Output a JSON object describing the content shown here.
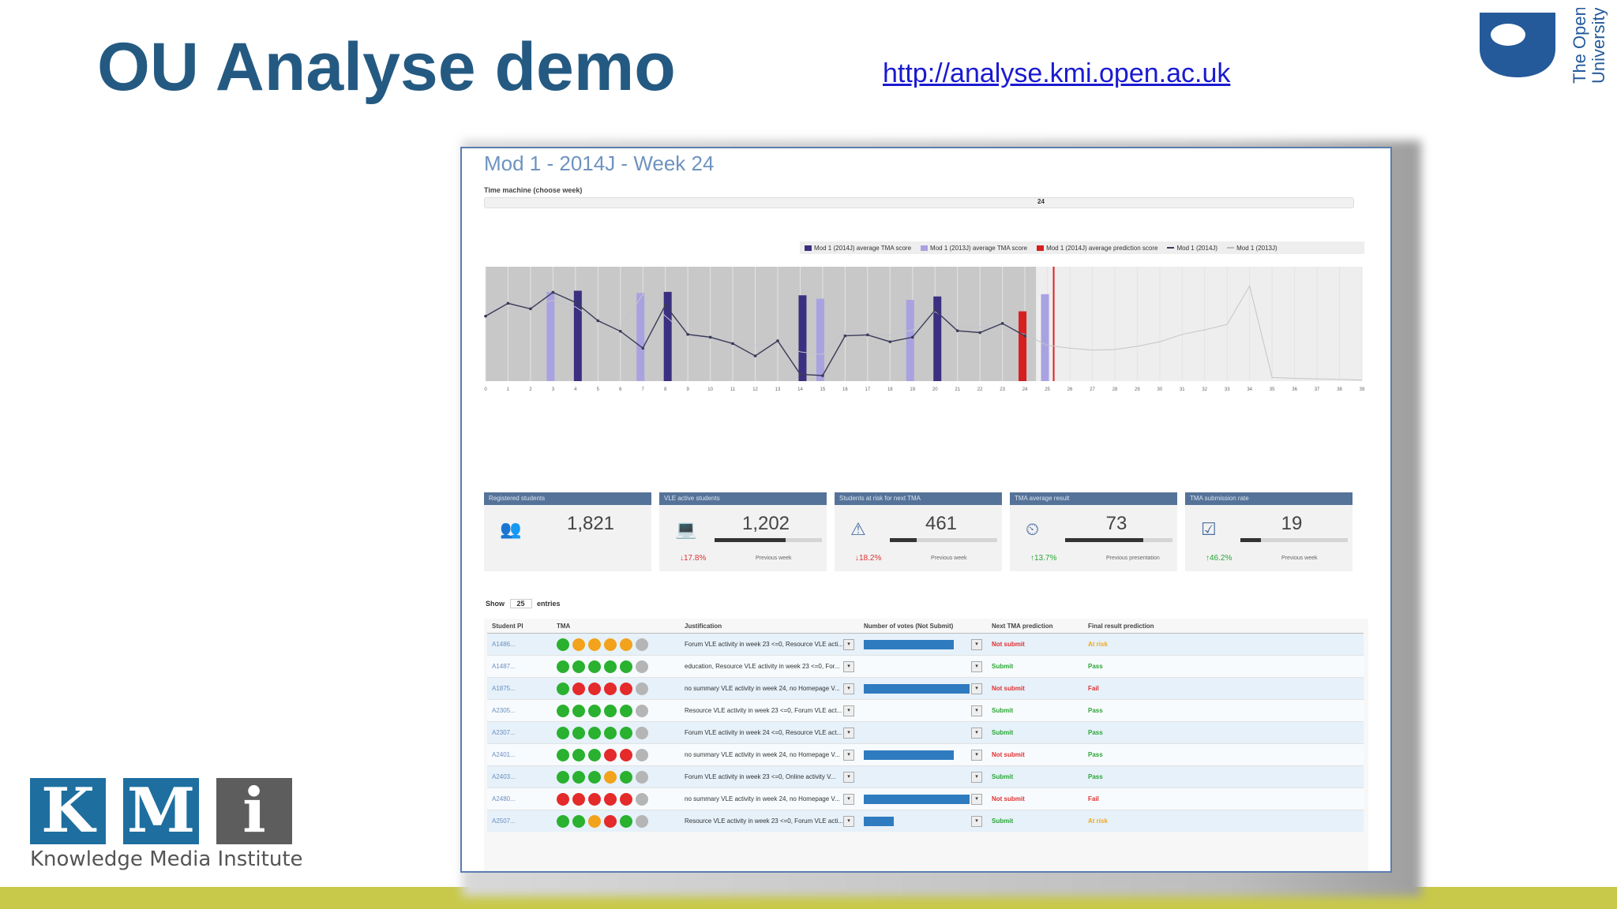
{
  "slide": {
    "title": "OU Analyse demo",
    "link": "http://analyse.kmi.open.ac.uk",
    "ou_logo_text": "The Open University",
    "kmi_letters": [
      "K",
      "M",
      "i"
    ],
    "kmi_subtitle": "Knowledge Media Institute",
    "band_color": "#c8c94a"
  },
  "app": {
    "title": "Mod 1 - 2014J - Week 24",
    "time_label": "Time machine (choose week)",
    "time_value": "24",
    "legend": [
      {
        "label": "Mod 1 (2014J) average TMA score",
        "color": "#3a2f80"
      },
      {
        "label": "Mod 1 (2013J) average TMA score",
        "color": "#a9a2e0"
      },
      {
        "label": "Mod 1 (2014J) average prediction score",
        "color": "#d62020"
      },
      {
        "label": "Mod 1 (2014J)",
        "color": "#3a3a5a"
      },
      {
        "label": "Mod 1 (2013J)",
        "color": "#bbbbbb"
      }
    ]
  },
  "chart_data": {
    "type": "bar",
    "x": [
      0,
      1,
      2,
      3,
      4,
      5,
      6,
      7,
      8,
      9,
      10,
      11,
      12,
      13,
      14,
      15,
      16,
      17,
      18,
      19,
      20,
      21,
      22,
      23,
      24,
      25,
      26,
      27,
      28,
      29,
      30,
      31,
      32,
      33,
      34,
      35,
      36,
      37,
      38,
      39
    ],
    "current_week": 25,
    "series": [
      {
        "name": "Mod 1 (2014J) average TMA score",
        "bars": [
          {
            "week": 4,
            "value": 79
          },
          {
            "week": 8,
            "value": 78
          },
          {
            "week": 14,
            "value": 75
          },
          {
            "week": 20,
            "value": 74
          }
        ]
      },
      {
        "name": "Mod 1 (2013J) average TMA score",
        "bars": [
          {
            "week": 3,
            "value": 78
          },
          {
            "week": 7,
            "value": 77
          },
          {
            "week": 15,
            "value": 72
          },
          {
            "week": 19,
            "value": 71
          },
          {
            "week": 25,
            "value": 76
          }
        ]
      },
      {
        "name": "Mod 1 (2014J) average prediction score",
        "bars": [
          {
            "week": 24,
            "value": 61
          }
        ]
      },
      {
        "name": "Mod 1 (2014J)",
        "values": [
          1420,
          1700,
          1580,
          1940,
          1720,
          1320,
          1090,
          720,
          1660,
          1020,
          960,
          820,
          550,
          880,
          150,
          120,
          990,
          1010,
          860,
          960,
          1550,
          1100,
          1060,
          1260,
          990
        ]
      },
      {
        "name": "Mod 1 (2013J)",
        "values": [
          1560,
          1600,
          1640,
          1760,
          1620,
          1300,
          1160,
          1900,
          1420,
          1000,
          920,
          840,
          780,
          820,
          640,
          580,
          1080,
          1040,
          1000,
          1120,
          1520,
          1200,
          1180,
          1160,
          1020,
          780,
          720,
          680,
          690,
          760,
          860,
          1020,
          1120,
          1240,
          2080,
          80,
          60,
          50,
          40,
          20
        ]
      }
    ],
    "ylim_left": [
      0,
      2500
    ],
    "ylim_right": [
      0,
      100
    ]
  },
  "stats": [
    {
      "header": "Registered students",
      "icon": "users-icon",
      "glyph": "👥",
      "value": "1,821",
      "progress": null,
      "change": "",
      "change_dir": "",
      "footer": ""
    },
    {
      "header": "VLE active students",
      "icon": "laptop-icon",
      "glyph": "💻",
      "value": "1,202",
      "progress": 0.66,
      "change": "17.8%",
      "change_dir": "down",
      "footer": "Previous week"
    },
    {
      "header": "Students at risk for next TMA",
      "icon": "warning-icon",
      "glyph": "⚠",
      "value": "461",
      "progress": 0.25,
      "change": "18.2%",
      "change_dir": "down",
      "footer": "Previous week"
    },
    {
      "header": "TMA average result",
      "icon": "dashboard-icon",
      "glyph": "⏲",
      "value": "73",
      "progress": 0.73,
      "change": "13.7%",
      "change_dir": "up",
      "footer": "Previous presentation"
    },
    {
      "header": "TMA submission rate",
      "icon": "checkbox-icon",
      "glyph": "☑",
      "value": "19",
      "progress": 0.19,
      "change": "46.2%",
      "change_dir": "up",
      "footer": "Previous week"
    }
  ],
  "table": {
    "show_label": "Show",
    "show_value": "25",
    "show_suffix": "entries",
    "columns": [
      "Student PI",
      "TMA",
      "Justification",
      "Number of votes (Not Submit)",
      "Next TMA prediction",
      "Final result prediction"
    ],
    "rows": [
      {
        "id": "A1486...",
        "tma": [
          "g",
          "o",
          "o",
          "o",
          "o",
          "x"
        ],
        "justification": "Forum VLE activity in week 23 <=0, Resource VLE acti...",
        "votes": 0.85,
        "next": "Not submit",
        "final": "At risk"
      },
      {
        "id": "A1487...",
        "tma": [
          "g",
          "g",
          "g",
          "g",
          "g",
          "x"
        ],
        "justification": "education, Resource VLE activity in week 23 <=0, For...",
        "votes": 0,
        "next": "Submit",
        "final": "Pass"
      },
      {
        "id": "A1875...",
        "tma": [
          "g",
          "r",
          "r",
          "r",
          "r",
          "x"
        ],
        "justification": "no summary VLE activity in week 24, no Homepage V...",
        "votes": 1.0,
        "next": "Not submit",
        "final": "Fail"
      },
      {
        "id": "A2305...",
        "tma": [
          "g",
          "g",
          "g",
          "g",
          "g",
          "x"
        ],
        "justification": "Resource VLE activity in week 23 <=0, Forum VLE act...",
        "votes": 0,
        "next": "Submit",
        "final": "Pass"
      },
      {
        "id": "A2307...",
        "tma": [
          "g",
          "g",
          "g",
          "g",
          "g",
          "x"
        ],
        "justification": "Forum VLE activity in week 24 <=0, Resource VLE act...",
        "votes": 0,
        "next": "Submit",
        "final": "Pass"
      },
      {
        "id": "A2401...",
        "tma": [
          "g",
          "g",
          "g",
          "r",
          "r",
          "x"
        ],
        "justification": "no summary VLE activity in week 24, no Homepage V...",
        "votes": 0.85,
        "next": "Not submit",
        "final": "Pass"
      },
      {
        "id": "A2403...",
        "tma": [
          "g",
          "g",
          "g",
          "o",
          "g",
          "x"
        ],
        "justification": "Forum VLE activity in week 23 <=0, Online activity V...",
        "votes": 0,
        "next": "Submit",
        "final": "Pass"
      },
      {
        "id": "A2480...",
        "tma": [
          "r",
          "r",
          "r",
          "r",
          "r",
          "x"
        ],
        "justification": "no summary VLE activity in week 24, no Homepage V...",
        "votes": 1.0,
        "next": "Not submit",
        "final": "Fail"
      },
      {
        "id": "A2507...",
        "tma": [
          "g",
          "g",
          "o",
          "r",
          "g",
          "x"
        ],
        "justification": "Resource VLE activity in week 23 <=0, Forum VLE acti...",
        "votes": 0.28,
        "next": "Submit",
        "final": "At risk"
      }
    ]
  }
}
